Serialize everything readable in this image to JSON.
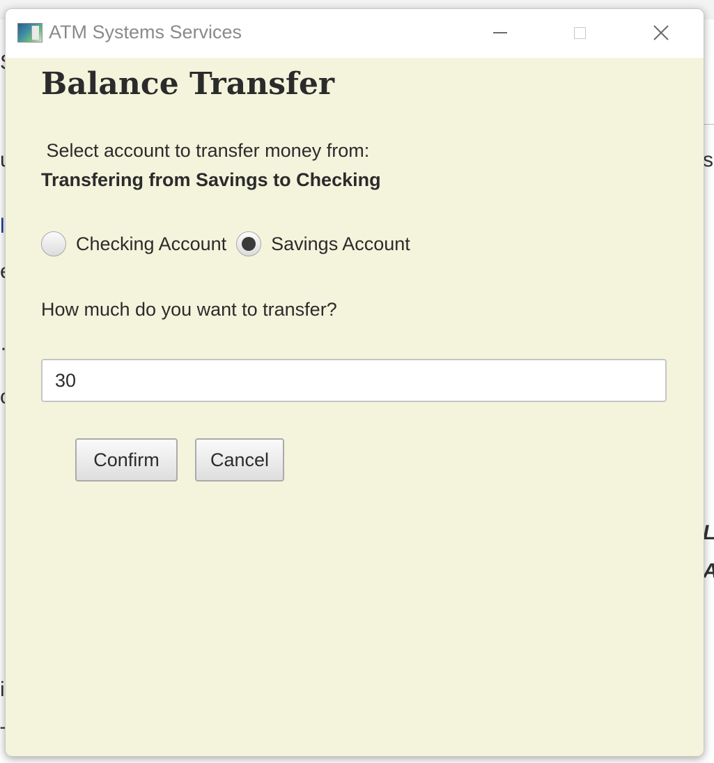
{
  "background_window": {
    "fragments": [
      "S",
      "u",
      "ss",
      "l",
      "e",
      "·",
      "o",
      "LL",
      "A",
      "i",
      "T"
    ]
  },
  "dialog": {
    "title": "ATM Systems Services",
    "controls": {
      "minimize_icon": "minimize-icon",
      "maximize_icon": "maximize-icon",
      "close_icon": "close-icon",
      "close_glyph": "✕"
    },
    "heading": "Balance Transfer",
    "prompt": " Select account to transfer money from:",
    "status": "Transfering from Savings to Checking",
    "accounts": [
      {
        "label": "Checking Account",
        "selected": false
      },
      {
        "label": "Savings Account",
        "selected": true
      }
    ],
    "question": "How much do you want to transfer?",
    "amount": {
      "value": "30",
      "placeholder": ""
    },
    "buttons": {
      "confirm": "Confirm",
      "cancel": "Cancel"
    }
  },
  "colors": {
    "dialog_background": "#f4f3dc",
    "titlebar_background": "#ffffff",
    "text": "#2b2b2b"
  }
}
